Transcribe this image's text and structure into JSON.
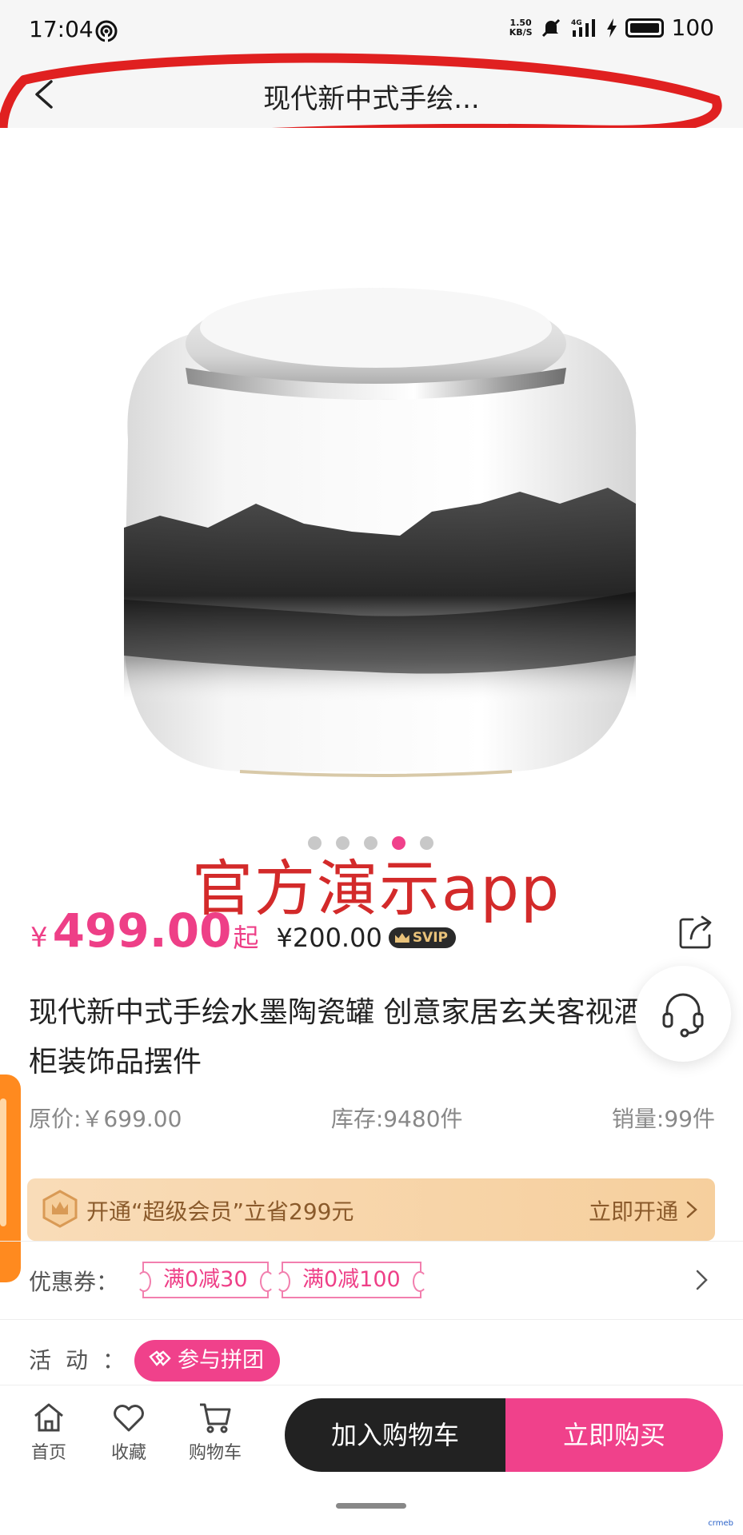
{
  "status_bar": {
    "time": "17:04",
    "net_speed_top": "1.50",
    "net_speed_bottom": "KB/S",
    "battery": "100",
    "icons": [
      "hotspot-icon",
      "mute-icon",
      "signal-4g-icon",
      "charging-icon",
      "battery-icon"
    ]
  },
  "nav": {
    "back_icon": "chevron-left-icon",
    "title": "现代新中式手绘..."
  },
  "gallery": {
    "total_dots": 5,
    "active_dot": 4
  },
  "watermark": "官方演示app",
  "price": {
    "symbol": "¥",
    "value": "499.00",
    "suffix": "起",
    "svip_price": "¥200.00",
    "svip_badge": "SVIP"
  },
  "product": {
    "title": "现代新中式手绘水墨陶瓷罐 创意家居玄关客视酒柜装饰品摆件",
    "original_price": "原价:￥699.00",
    "stock": "库存:9480件",
    "sales": "销量:99件"
  },
  "member": {
    "text": "开通“超级会员”立省299元",
    "action": "立即开通"
  },
  "coupons": {
    "label": "优惠券：",
    "items": [
      "满0减30",
      "满0减100"
    ]
  },
  "activity": {
    "label": "活动：",
    "pill": "参与拼团"
  },
  "bottom": {
    "tabs": [
      {
        "label": "首页",
        "icon": "home-icon"
      },
      {
        "label": "收藏",
        "icon": "heart-icon"
      },
      {
        "label": "购物车",
        "icon": "cart-icon"
      }
    ],
    "add_to_cart": "加入购物车",
    "buy_now": "立即购买"
  },
  "colors": {
    "accent": "#f0418b",
    "annotation": "#e02020",
    "member_bg": "#f6cf9d"
  },
  "corner_logo": "crmeb"
}
